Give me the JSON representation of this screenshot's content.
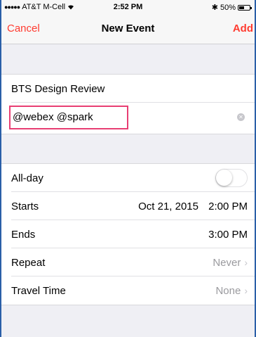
{
  "status_bar": {
    "signal": "●●●●●",
    "carrier": "AT&T M-Cell",
    "time": "2:52 PM",
    "bluetooth": "✱",
    "battery_text": "50%",
    "battery_level": 0.5
  },
  "nav": {
    "cancel": "Cancel",
    "title": "New Event",
    "add": "Add"
  },
  "event": {
    "title": "BTS Design Review",
    "location": "@webex @spark"
  },
  "fields": {
    "all_day": {
      "label": "All-day",
      "on": false
    },
    "starts": {
      "label": "Starts",
      "date": "Oct 21, 2015",
      "time": "2:00 PM"
    },
    "ends": {
      "label": "Ends",
      "time": "3:00 PM"
    },
    "repeat": {
      "label": "Repeat",
      "value": "Never"
    },
    "travel_time": {
      "label": "Travel Time",
      "value": "None"
    }
  },
  "colors": {
    "accent": "#ff3b30",
    "highlight": "#e83e73",
    "frame": "#2a5fa8"
  }
}
